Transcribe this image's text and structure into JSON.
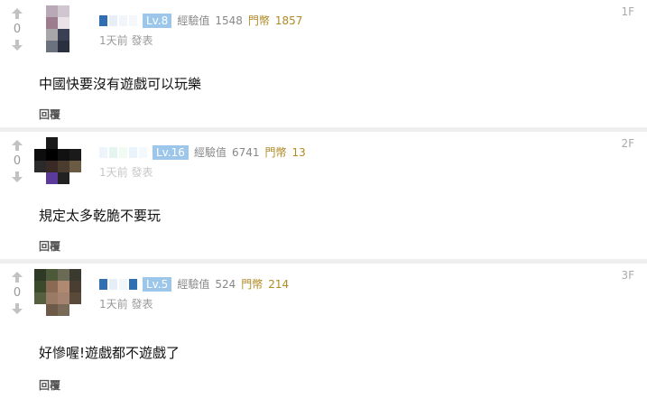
{
  "comments": [
    {
      "upvote_count": "0",
      "level": "Lv.8",
      "exp_label": "經驗值",
      "exp_value": "1548",
      "gold_label": "門幣",
      "gold_value": "1857",
      "time": "1天前",
      "publish_label": "發表",
      "floor": "1F",
      "content": "中國快要沒有遊戲可以玩樂",
      "reply_label": "回覆"
    },
    {
      "upvote_count": "0",
      "level": "Lv.16",
      "exp_label": "經驗值",
      "exp_value": "6741",
      "gold_label": "門幣",
      "gold_value": "13",
      "time": "1天前",
      "publish_label": "發表",
      "floor": "2F",
      "content": "規定太多乾脆不要玩",
      "reply_label": "回覆"
    },
    {
      "upvote_count": "0",
      "level": "Lv.5",
      "exp_label": "經驗值",
      "exp_value": "524",
      "gold_label": "門幣",
      "gold_value": "214",
      "time": "1天前",
      "publish_label": "發表",
      "floor": "3F",
      "content": "好慘喔!遊戲都不遊戲了",
      "reply_label": "回覆"
    }
  ],
  "colors": {
    "level_badge": "#9cc7ea",
    "gold_text": "#b08a27",
    "separator": "#eeeeee"
  },
  "icons": {
    "upvote": "arrow-up-icon",
    "downvote": "arrow-down-icon"
  }
}
